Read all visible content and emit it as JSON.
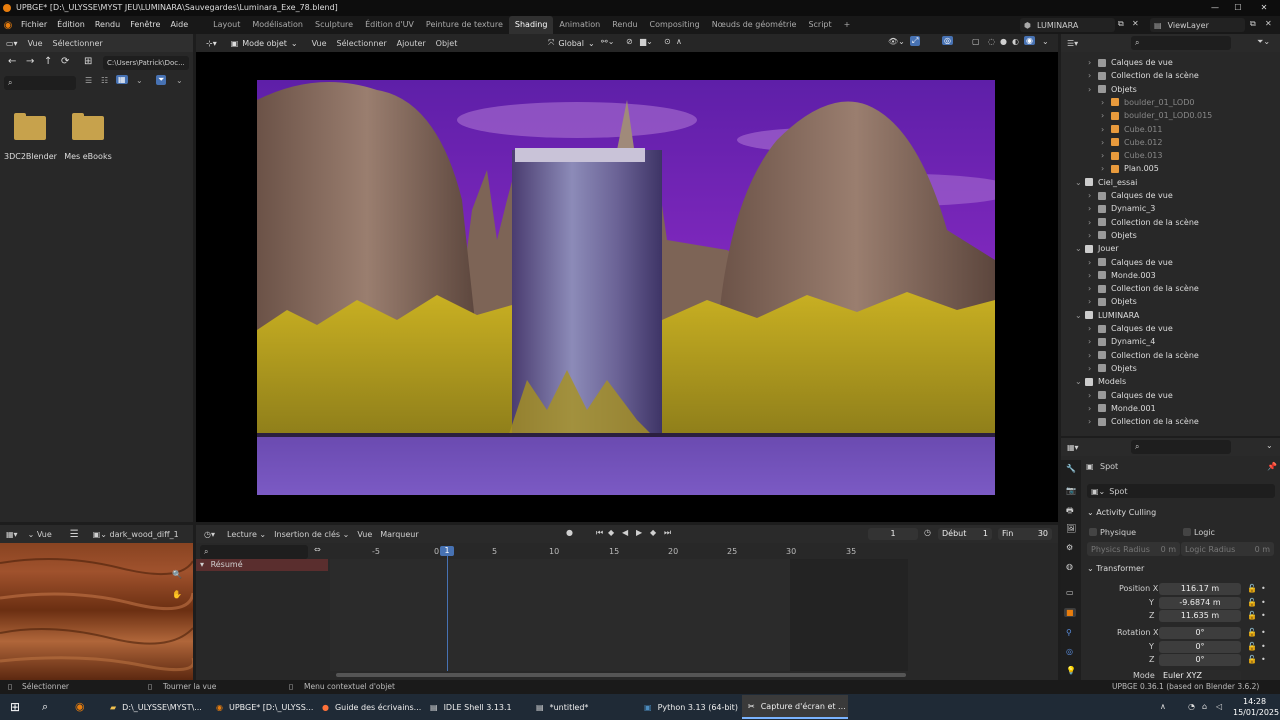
{
  "title": "UPBGE* [D:\\_ULYSSE\\MYST JEU\\LUMINARA\\Sauvegardes\\Luminara_Exe_78.blend]",
  "menu": [
    "Fichier",
    "Édition",
    "Rendu",
    "Fenêtre",
    "Aide"
  ],
  "workspaces": [
    "Layout",
    "Modélisation",
    "Sculpture",
    "Édition d'UV",
    "Peinture de texture",
    "Shading",
    "Animation",
    "Rendu",
    "Compositing",
    "Nœuds de géométrie",
    "Script"
  ],
  "active_workspace": "Shading",
  "scene_name": "LUMINARA",
  "viewlayer_name": "ViewLayer",
  "filebrowser": {
    "menu_vue": "Vue",
    "menu_select": "Sélectionner",
    "path": "C:\\Users\\Patrick\\Doc...",
    "folders": [
      "3DC2Blender",
      "Mes eBooks"
    ]
  },
  "viewport": {
    "mode": "Mode objet",
    "menu": [
      "Vue",
      "Sélectionner",
      "Ajouter",
      "Objet"
    ],
    "orientation": "Global"
  },
  "image_editor": {
    "menu_vue": "Vue",
    "image_name": "dark_wood_diff_1"
  },
  "timeline": {
    "menu": [
      "Lecture",
      "Insertion de clés",
      "Vue",
      "Marqueur"
    ],
    "current_frame": "1",
    "start_label": "Début",
    "start": "1",
    "end_label": "Fin",
    "end": "30",
    "ticks": [
      "-5",
      "0",
      "5",
      "10",
      "15",
      "20",
      "25",
      "30",
      "35"
    ],
    "summary": "Résumé",
    "cursor_frame": "1"
  },
  "outliner": {
    "rows": [
      {
        "label": "Calques de vue",
        "depth": 2
      },
      {
        "label": "Collection de la scène",
        "depth": 2
      },
      {
        "label": "Objets",
        "depth": 2
      },
      {
        "label": "boulder_01_LOD0",
        "depth": 3,
        "dim": true
      },
      {
        "label": "boulder_01_LOD0.015",
        "depth": 3,
        "dim": true
      },
      {
        "label": "Cube.011",
        "depth": 3,
        "dim": true
      },
      {
        "label": "Cube.012",
        "depth": 3,
        "dim": true
      },
      {
        "label": "Cube.013",
        "depth": 3,
        "dim": true
      },
      {
        "label": "Plan.005",
        "depth": 3
      },
      {
        "label": "Ciel_essai",
        "depth": 1
      },
      {
        "label": "Calques de vue",
        "depth": 2
      },
      {
        "label": "Dynamic_3",
        "depth": 2
      },
      {
        "label": "Collection de la scène",
        "depth": 2
      },
      {
        "label": "Objets",
        "depth": 2
      },
      {
        "label": "Jouer",
        "depth": 1
      },
      {
        "label": "Calques de vue",
        "depth": 2
      },
      {
        "label": "Monde.003",
        "depth": 2
      },
      {
        "label": "Collection de la scène",
        "depth": 2
      },
      {
        "label": "Objets",
        "depth": 2
      },
      {
        "label": "LUMINARA",
        "depth": 1
      },
      {
        "label": "Calques de vue",
        "depth": 2
      },
      {
        "label": "Dynamic_4",
        "depth": 2
      },
      {
        "label": "Collection de la scène",
        "depth": 2
      },
      {
        "label": "Objets",
        "depth": 2
      },
      {
        "label": "Models",
        "depth": 1
      },
      {
        "label": "Calques de vue",
        "depth": 2
      },
      {
        "label": "Monde.001",
        "depth": 2
      },
      {
        "label": "Collection de la scène",
        "depth": 2
      }
    ]
  },
  "properties": {
    "object_name": "Spot",
    "data_name": "Spot",
    "activity_culling": "Activity Culling",
    "physique": "Physique",
    "logic": "Logic",
    "physics_radius_label": "Physics Radius",
    "physics_radius": "0 m",
    "logic_radius_label": "Logic Radius",
    "logic_radius": "0 m",
    "transform": "Transformer",
    "position_label": "Position X",
    "pos_x": "116.17 m",
    "pos_y": "-9.6874 m",
    "pos_z": "11.635 m",
    "rotation_label": "Rotation X",
    "rot_x": "0°",
    "rot_y": "0°",
    "rot_z": "0°",
    "y_label": "Y",
    "z_label": "Z",
    "mode_label": "Mode",
    "mode_value": "Euler XYZ"
  },
  "statusbar": {
    "select": "Sélectionner",
    "rotate": "Tourner la vue",
    "context": "Menu contextuel d'objet",
    "version": "UPBGE 0.36.1 (based on Blender 3.6.2)"
  },
  "taskbar": {
    "items": [
      "D:\\_ULYSSE\\MYST\\...",
      "UPBGE* [D:\\_ULYSS...",
      "Guide des écrivains...",
      "IDLE Shell 3.13.1",
      "*untitled*",
      "Python 3.13 (64-bit)",
      "Capture d'écran et ..."
    ],
    "time": "14:28",
    "date": "15/01/2025"
  }
}
